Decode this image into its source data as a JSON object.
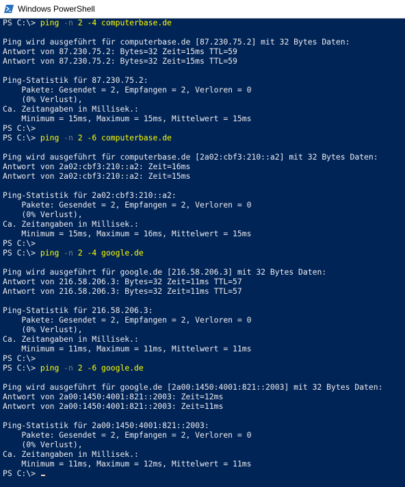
{
  "window": {
    "title": "Windows PowerShell",
    "icon": "powershell-icon"
  },
  "colors": {
    "background": "#012456",
    "text": "#eeedf0",
    "command": "#ffff00",
    "option": "#808080",
    "cursor": "#fedba9"
  },
  "console": {
    "lines": [
      {
        "type": "command",
        "prompt": "PS C:\\> ",
        "cmd": "ping",
        "opt": "-n",
        "args": " 2 -4 computerbase.de"
      },
      {
        "type": "text",
        "text": ""
      },
      {
        "type": "text",
        "text": "Ping wird ausgeführt für computerbase.de [87.230.75.2] mit 32 Bytes Daten:"
      },
      {
        "type": "text",
        "text": "Antwort von 87.230.75.2: Bytes=32 Zeit=15ms TTL=59"
      },
      {
        "type": "text",
        "text": "Antwort von 87.230.75.2: Bytes=32 Zeit=15ms TTL=59"
      },
      {
        "type": "text",
        "text": ""
      },
      {
        "type": "text",
        "text": "Ping-Statistik für 87.230.75.2:"
      },
      {
        "type": "text",
        "text": "    Pakete: Gesendet = 2, Empfangen = 2, Verloren = 0"
      },
      {
        "type": "text",
        "text": "    (0% Verlust),"
      },
      {
        "type": "text",
        "text": "Ca. Zeitangaben in Millisek.:"
      },
      {
        "type": "text",
        "text": "    Minimum = 15ms, Maximum = 15ms, Mittelwert = 15ms"
      },
      {
        "type": "text",
        "text": "PS C:\\>"
      },
      {
        "type": "command",
        "prompt": "PS C:\\> ",
        "cmd": "ping",
        "opt": "-n",
        "args": " 2 -6 computerbase.de"
      },
      {
        "type": "text",
        "text": ""
      },
      {
        "type": "text",
        "text": "Ping wird ausgeführt für computerbase.de [2a02:cbf3:210::a2] mit 32 Bytes Daten:"
      },
      {
        "type": "text",
        "text": "Antwort von 2a02:cbf3:210::a2: Zeit=16ms"
      },
      {
        "type": "text",
        "text": "Antwort von 2a02:cbf3:210::a2: Zeit=15ms"
      },
      {
        "type": "text",
        "text": ""
      },
      {
        "type": "text",
        "text": "Ping-Statistik für 2a02:cbf3:210::a2:"
      },
      {
        "type": "text",
        "text": "    Pakete: Gesendet = 2, Empfangen = 2, Verloren = 0"
      },
      {
        "type": "text",
        "text": "    (0% Verlust),"
      },
      {
        "type": "text",
        "text": "Ca. Zeitangaben in Millisek.:"
      },
      {
        "type": "text",
        "text": "    Minimum = 15ms, Maximum = 16ms, Mittelwert = 15ms"
      },
      {
        "type": "text",
        "text": "PS C:\\>"
      },
      {
        "type": "command",
        "prompt": "PS C:\\> ",
        "cmd": "ping",
        "opt": "-n",
        "args": " 2 -4 google.de"
      },
      {
        "type": "text",
        "text": ""
      },
      {
        "type": "text",
        "text": "Ping wird ausgeführt für google.de [216.58.206.3] mit 32 Bytes Daten:"
      },
      {
        "type": "text",
        "text": "Antwort von 216.58.206.3: Bytes=32 Zeit=11ms TTL=57"
      },
      {
        "type": "text",
        "text": "Antwort von 216.58.206.3: Bytes=32 Zeit=11ms TTL=57"
      },
      {
        "type": "text",
        "text": ""
      },
      {
        "type": "text",
        "text": "Ping-Statistik für 216.58.206.3:"
      },
      {
        "type": "text",
        "text": "    Pakete: Gesendet = 2, Empfangen = 2, Verloren = 0"
      },
      {
        "type": "text",
        "text": "    (0% Verlust),"
      },
      {
        "type": "text",
        "text": "Ca. Zeitangaben in Millisek.:"
      },
      {
        "type": "text",
        "text": "    Minimum = 11ms, Maximum = 11ms, Mittelwert = 11ms"
      },
      {
        "type": "text",
        "text": "PS C:\\>"
      },
      {
        "type": "command",
        "prompt": "PS C:\\> ",
        "cmd": "ping",
        "opt": "-n",
        "args": " 2 -6 google.de"
      },
      {
        "type": "text",
        "text": ""
      },
      {
        "type": "text",
        "text": "Ping wird ausgeführt für google.de [2a00:1450:4001:821::2003] mit 32 Bytes Daten:"
      },
      {
        "type": "text",
        "text": "Antwort von 2a00:1450:4001:821::2003: Zeit=12ms"
      },
      {
        "type": "text",
        "text": "Antwort von 2a00:1450:4001:821::2003: Zeit=11ms"
      },
      {
        "type": "text",
        "text": ""
      },
      {
        "type": "text",
        "text": "Ping-Statistik für 2a00:1450:4001:821::2003:"
      },
      {
        "type": "text",
        "text": "    Pakete: Gesendet = 2, Empfangen = 2, Verloren = 0"
      },
      {
        "type": "text",
        "text": "    (0% Verlust),"
      },
      {
        "type": "text",
        "text": "Ca. Zeitangaben in Millisek.:"
      },
      {
        "type": "text",
        "text": "    Minimum = 11ms, Maximum = 12ms, Mittelwert = 11ms"
      },
      {
        "type": "prompt",
        "prompt": "PS C:\\> "
      }
    ]
  }
}
